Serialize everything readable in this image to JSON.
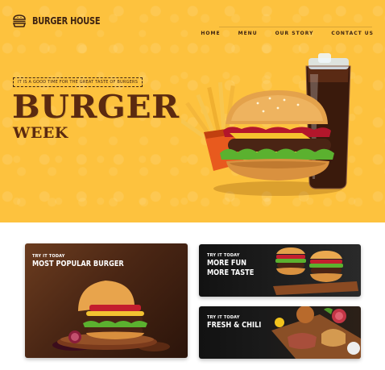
{
  "brand": {
    "name": "BURGER HOUSE",
    "logo_icon": "burger-icon",
    "color": "#3e2312"
  },
  "nav": {
    "items": [
      {
        "label": "HOME"
      },
      {
        "label": "MENU"
      },
      {
        "label": "OUR STORY"
      },
      {
        "label": "CONTACT US"
      }
    ]
  },
  "hero": {
    "tagline": "IT IS A GOOD TIME FOR THE GREAT TASTE OF BURGERS",
    "title": "BURGER",
    "subtitle": "WEEK",
    "background_color": "#fdc23e",
    "title_color": "#5b2a10"
  },
  "cards": [
    {
      "eyebrow": "TRY IT TODAY",
      "heading": "MOST POPULAR BURGER"
    },
    {
      "eyebrow": "TRY IT TODAY",
      "heading_line1": "MORE FUN",
      "heading_line2": "MORE TASTE"
    },
    {
      "eyebrow": "TRY IT TODAY",
      "heading": "FRESH & CHILI"
    }
  ]
}
